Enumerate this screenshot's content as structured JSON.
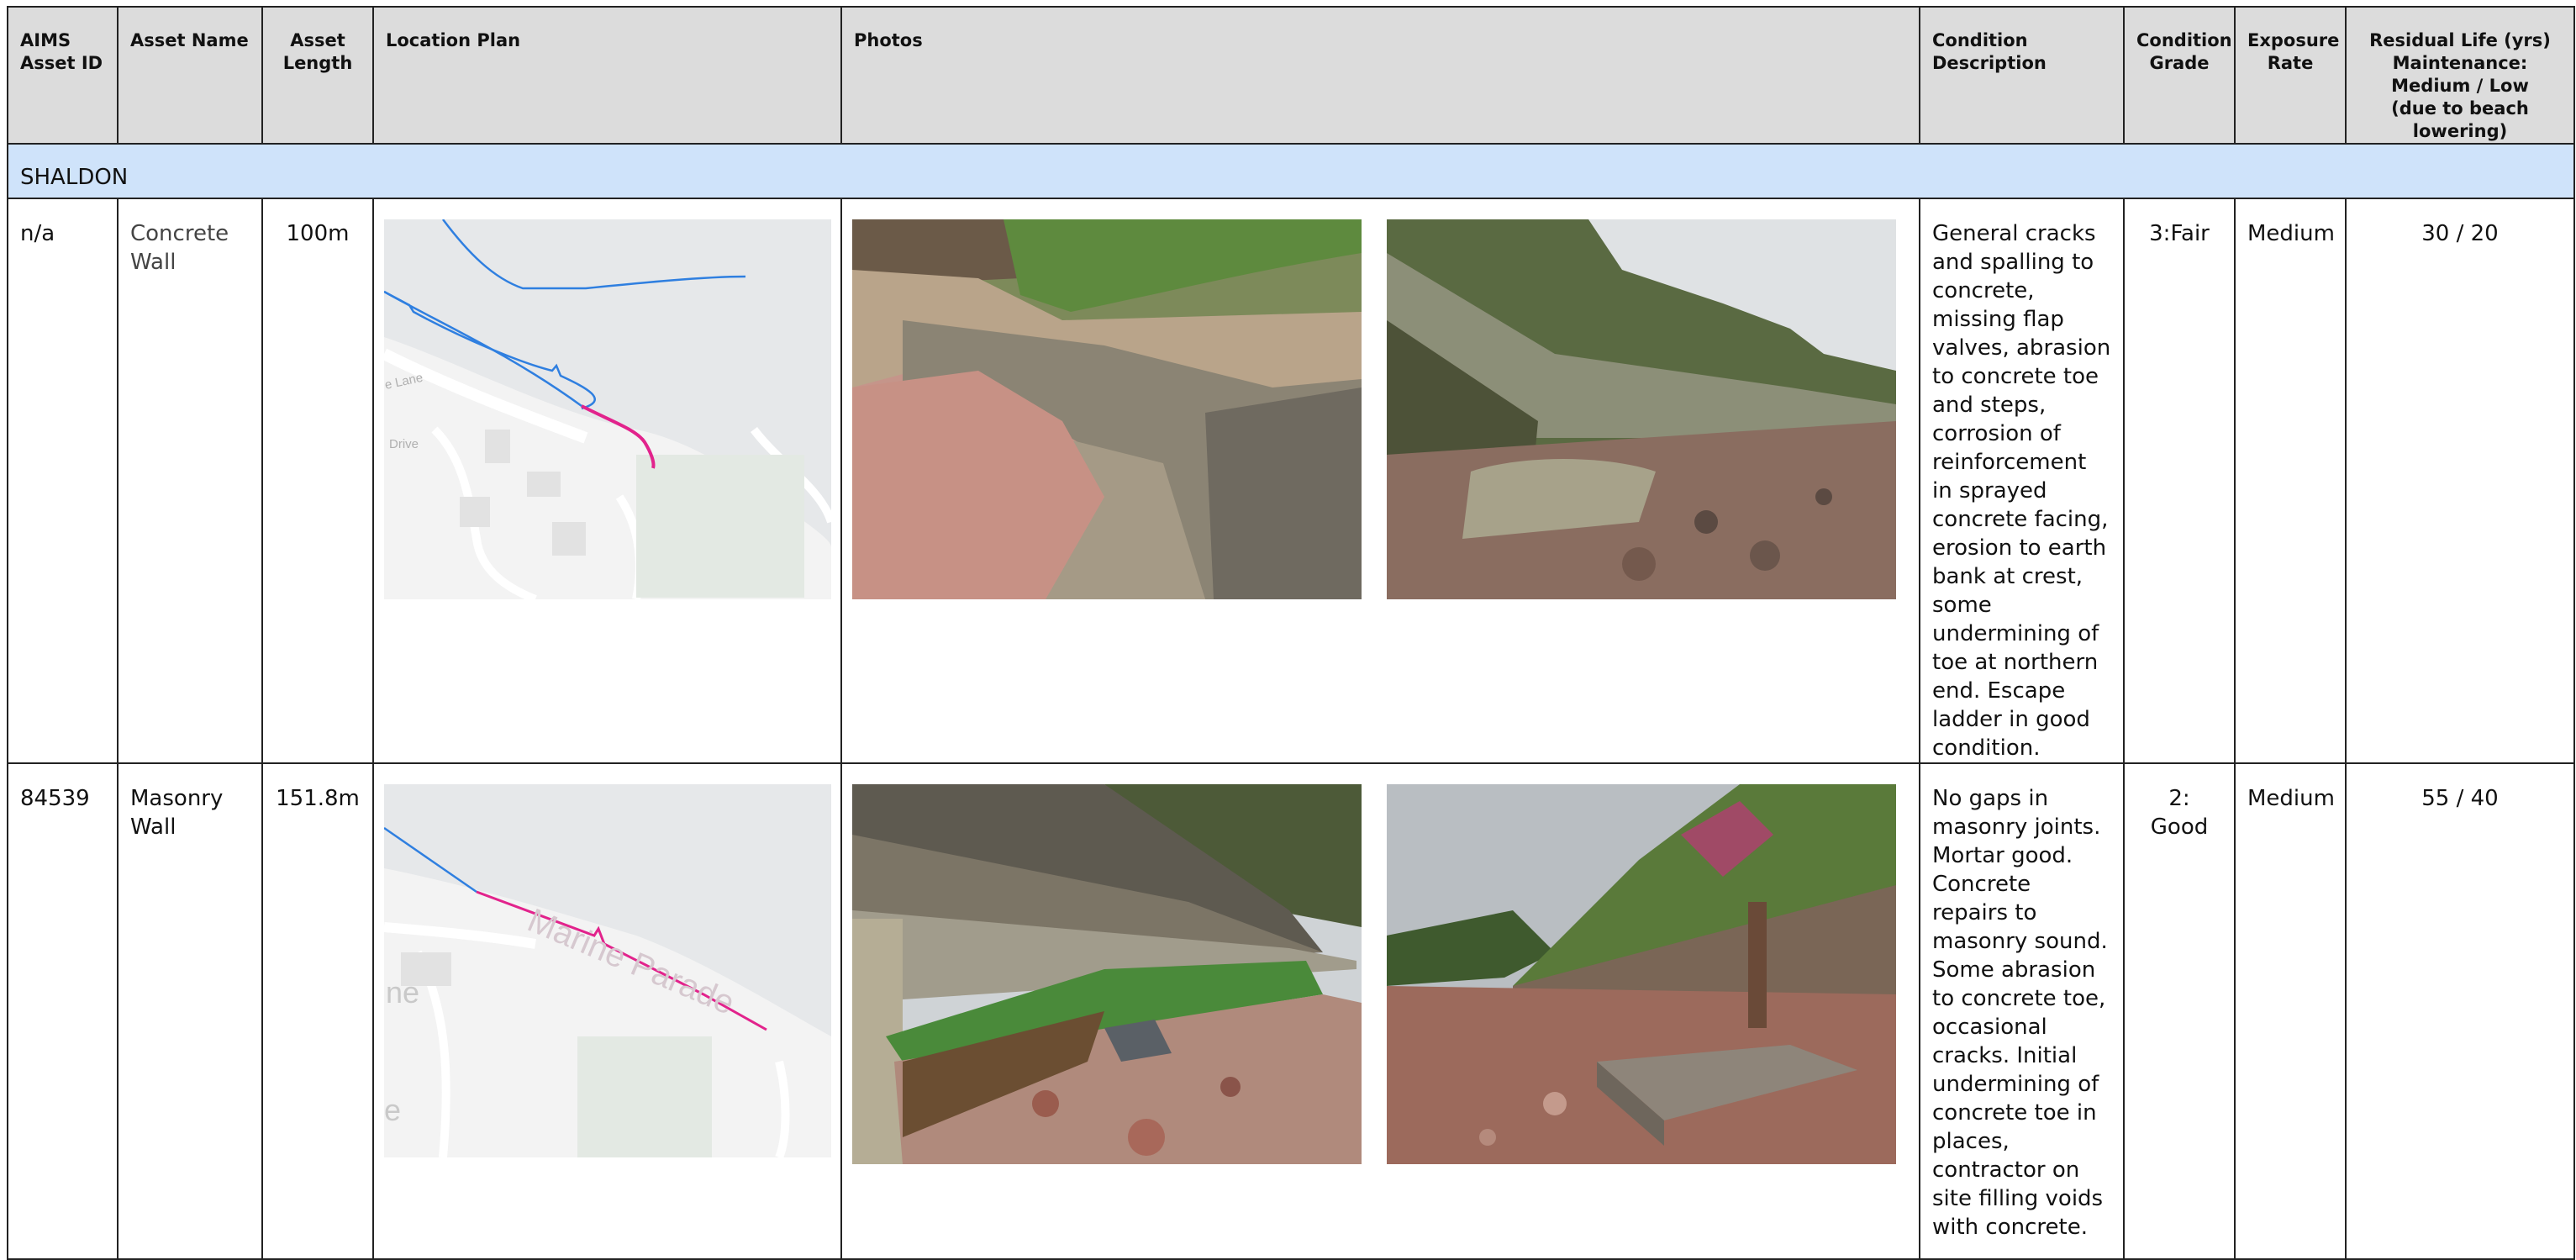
{
  "headers": {
    "asset_id": "AIMS\nAsset ID",
    "asset_name": "Asset Name",
    "asset_length": "Asset\nLength",
    "location_plan": "Location Plan",
    "photos": "Photos",
    "condition_description": "Condition Description",
    "condition_grade": "Condition\nGrade",
    "exposure_rate": "Exposure\nRate",
    "residual_life": "Residual Life (yrs)\nMaintenance:\nMedium / Low\n(due to beach lowering)"
  },
  "section": "SHALDON",
  "rows": [
    {
      "asset_id": "n/a",
      "asset_name": "Concrete\nWall",
      "asset_length": "100m",
      "condition_description": "General cracks and spalling to concrete, missing flap valves, abrasion to concrete toe and steps, corrosion of reinforcement in sprayed concrete facing, erosion to earth bank at crest, some undermining of toe at northern end. Escape ladder in good condition.",
      "condition_grade": "3:Fair",
      "exposure_rate": "Medium",
      "residual_life": "30 / 20",
      "map_labels": [
        "e Lane",
        "Drive"
      ]
    },
    {
      "asset_id": "84539",
      "asset_name": "Masonry\nWall",
      "asset_length": "151.8m",
      "condition_description": "No gaps in masonry joints. Mortar good. Concrete repairs to masonry sound. Some abrasion to concrete toe, occasional cracks. Initial undermining of concrete toe in places, contractor on site filling voids with concrete.",
      "condition_grade": "2: Good",
      "exposure_rate": "Medium",
      "residual_life": "55 / 40",
      "map_labels": [
        "Marine Parade",
        "ne",
        "e"
      ]
    }
  ],
  "colors": {
    "header_bg": "#dcdcdc",
    "section_bg": "#cfe3fa",
    "asset_line_blue": "#2f7fe0",
    "asset_line_pink": "#e2238c",
    "map_sea": "#e6e8ea",
    "map_land": "#f3f3f3"
  }
}
